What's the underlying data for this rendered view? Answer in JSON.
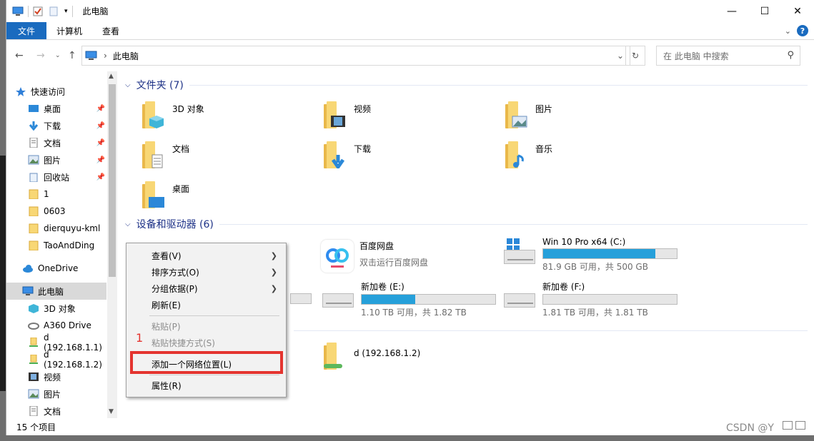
{
  "window": {
    "title": "此电脑",
    "controls": {
      "minimize": "—",
      "maximize": "☐",
      "close": "✕"
    }
  },
  "ribbon": {
    "tabs": [
      "文件",
      "计算机",
      "查看"
    ],
    "help": "?"
  },
  "address": {
    "path": "此电脑",
    "search_placeholder": "在 此电脑 中搜索"
  },
  "nav": {
    "items": [
      {
        "label": "快速访问",
        "icon": "star-icon"
      },
      {
        "label": "桌面",
        "icon": "desktop-icon",
        "pinned": true
      },
      {
        "label": "下载",
        "icon": "download-icon",
        "pinned": true
      },
      {
        "label": "文档",
        "icon": "document-icon",
        "pinned": true
      },
      {
        "label": "图片",
        "icon": "picture-icon",
        "pinned": true
      },
      {
        "label": "回收站",
        "icon": "recycle-icon",
        "pinned": true
      },
      {
        "label": "1",
        "icon": "folder-icon"
      },
      {
        "label": "0603",
        "icon": "folder-icon"
      },
      {
        "label": "dierquyu-kml",
        "icon": "folder-icon"
      },
      {
        "label": "TaoAndDing",
        "icon": "folder-icon"
      },
      {
        "label": "OneDrive",
        "icon": "cloud-icon"
      },
      {
        "label": "此电脑",
        "icon": "pc-icon",
        "selected": true
      },
      {
        "label": "3D 对象",
        "icon": "3d-icon"
      },
      {
        "label": "A360 Drive",
        "icon": "a360-icon"
      },
      {
        "label": "d (192.168.1.1)",
        "icon": "network-folder-icon"
      },
      {
        "label": "d (192.168.1.2)",
        "icon": "network-folder-icon"
      },
      {
        "label": "视频",
        "icon": "video-icon"
      },
      {
        "label": "图片",
        "icon": "picture-icon"
      },
      {
        "label": "文档",
        "icon": "document-icon"
      }
    ]
  },
  "groups": {
    "folders": {
      "title": "文件夹 (7)",
      "items": [
        "3D 对象",
        "视频",
        "图片",
        "文档",
        "下载",
        "音乐",
        "桌面"
      ]
    },
    "devices": {
      "title": "设备和驱动器 (6)",
      "baidu": {
        "name": "百度网盘",
        "sub": "双击运行百度网盘"
      },
      "drives": [
        {
          "name": "Win 10 Pro x64 (C:)",
          "free": "81.9 GB 可用，共 500 GB",
          "used_fraction": 0.84
        },
        {
          "name": "新加卷 (E:)",
          "free": "1.10 TB 可用，共 1.82 TB",
          "used_fraction": 0.4
        },
        {
          "name": "新加卷 (F:)",
          "free": "1.81 TB 可用，共 1.81 TB",
          "used_fraction": 0.0
        }
      ]
    },
    "network": {
      "items": [
        "d (192.168.1.2)"
      ]
    }
  },
  "context_menu": {
    "items": [
      {
        "label": "查看(V)",
        "submenu": true
      },
      {
        "label": "排序方式(O)",
        "submenu": true
      },
      {
        "label": "分组依据(P)",
        "submenu": true
      },
      {
        "label": "刷新(E)"
      },
      {
        "label": "粘贴(P)",
        "disabled": true
      },
      {
        "label": "粘贴快捷方式(S)",
        "disabled": true
      },
      {
        "label": "添加一个网络位置(L)",
        "highlighted": true
      },
      {
        "label": "属性(R)"
      }
    ],
    "annotation": "1"
  },
  "status": {
    "count": "15 个项目"
  },
  "watermark": "CSDN @Y"
}
